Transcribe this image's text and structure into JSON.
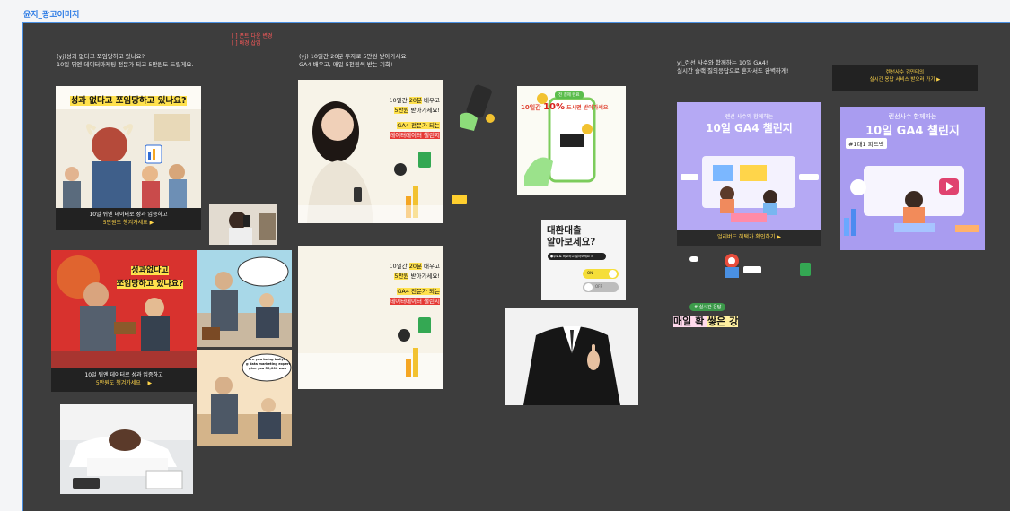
{
  "frame": {
    "title": "윤지_광고이미지"
  },
  "notes": {
    "red": [
      "[ ] 폰트 다운 변경",
      "[ ] 배경 삽입"
    ],
    "left": "(yj)성과 없다고 쪼임당하고 있나요?\n10일 뒤엔 데이터마케팅 전문가 되고 5만원도 드릴게요.",
    "mid": "(yj) 10일간 20분 투자로 5만원 받아가세요\nGA4 배우고, 매일 5천원씩 받는 기회!",
    "right": "yj_런선 사수와 함께하는 10일 GA4!\n실시간 슬랙 질의응답으로 혼자서도 완벽하게!"
  },
  "ad1": {
    "headline": "성과 없다고 쪼임당하고 있나요?",
    "cap1": "10일 뒤엔 데이터로 성과 입증하고",
    "cap2": "5만원도 챙겨가세요 ▶"
  },
  "ad2": {
    "headline1": "성과없다고",
    "headline2": "쪼임당하고 있나요?",
    "cap1": "10일 뒤엔 데이터로 성과 입증하고",
    "cap2": "5만원도 챙겨가세요"
  },
  "speech": {
    "text": "Are you being bullyin\ng data marketing expert\ngive you 50,000 won"
  },
  "ad3": {
    "line1a": "10일간 ",
    "line1b": "20분",
    "line1c": " 배우고",
    "line2a": "5만원",
    "line2b": " 받아가세요!",
    "line3": "GA4 전문가 되는",
    "line4": "데이터데이터 챌린지"
  },
  "ad4": {
    "line1a": "10일간 ",
    "line1b": "20분",
    "line1c": " 배우고",
    "line2a": "5만원",
    "line2b": " 받아가세요!",
    "line3": "GA4 전문가 되는",
    "line4": "데이터데이터 챌린지"
  },
  "phone_ad": {
    "badge": "전 결제 완료",
    "text_a": "10일간 ",
    "text_b": "10%",
    "text_c": " 드시면 받아가세요"
  },
  "loan": {
    "title1": "대환대출",
    "title2": "알아보세요?",
    "chip": "●무료로 비교하고 알아보세요 >",
    "toggle1": "ON",
    "toggle2": "OFF"
  },
  "ga4_a": {
    "sub": "렌선 사수와 함께하는",
    "title": "10일 GA4 챌린지",
    "footer": "얼리버드 혜택가 확인하기 ▶"
  },
  "ga4_b": {
    "sub": "렌선사수 함께하는",
    "title": "10일 GA4 챌린지",
    "tag": "#1대1 피드백"
  },
  "cta": {
    "line1": "렌선사수 김민태의",
    "line2": "실시간 응답 서비스 받으러 가기 ▶"
  },
  "live": {
    "badge": "# 실시간 응답",
    "text_a": "매일 확 ",
    "text_b": "쌓은 강"
  },
  "colors": {
    "accent": "#2c7be5",
    "frame_bg": "#3d3d3d",
    "yellow": "#ffd54a",
    "purple": "#9b8cf0"
  }
}
